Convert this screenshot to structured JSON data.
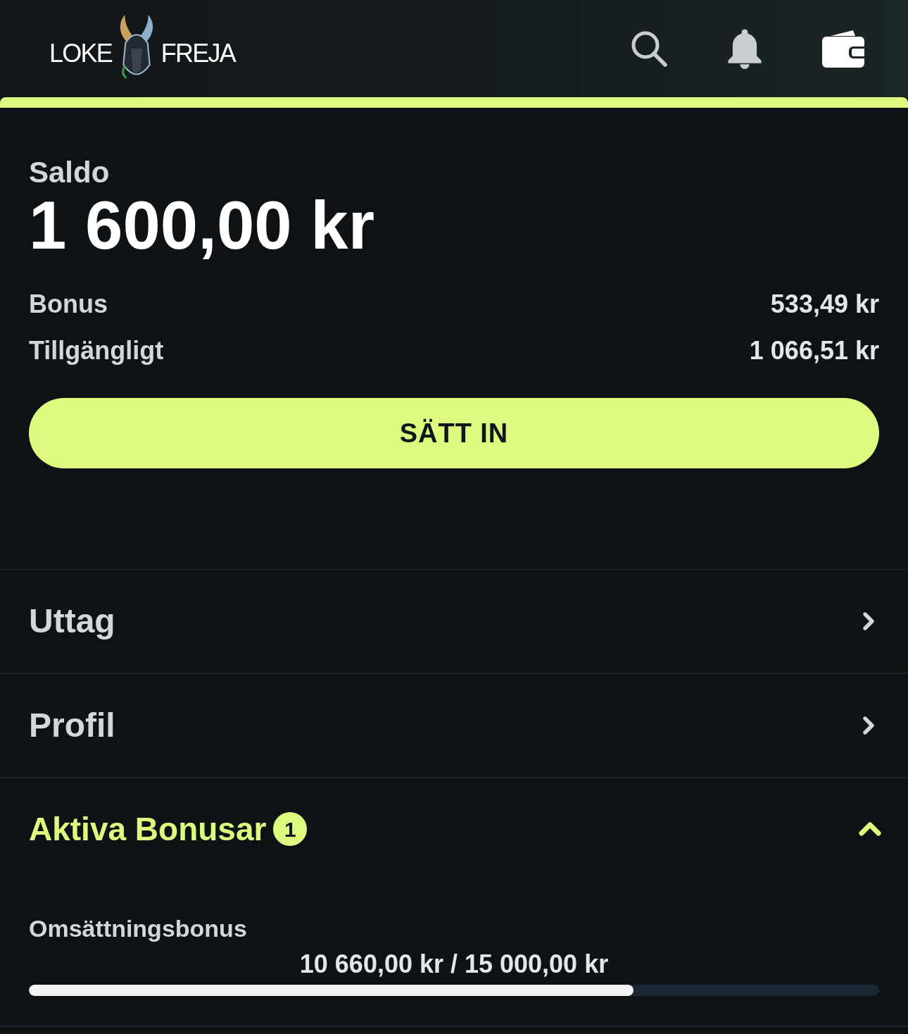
{
  "header": {
    "logo": {
      "left_text": "LOKE",
      "right_text": "FREJA"
    }
  },
  "balance": {
    "label": "Saldo",
    "amount": "1 600,00 kr",
    "rows": [
      {
        "label": "Bonus",
        "value": "533,49 kr"
      },
      {
        "label": "Tillgängligt",
        "value": "1 066,51 kr"
      }
    ],
    "deposit_button": {
      "label": "SÄTT IN"
    }
  },
  "menu": [
    {
      "label": "Uttag"
    },
    {
      "label": "Profil"
    }
  ],
  "active_bonuses": {
    "title": "Aktiva Bonusar",
    "count": "1",
    "expanded": true,
    "bonuses": [
      {
        "name": "Omsättningsbonus",
        "progress_text": "10 660,00 kr / 15 000,00 kr",
        "level": 0.7107
      }
    ]
  }
}
